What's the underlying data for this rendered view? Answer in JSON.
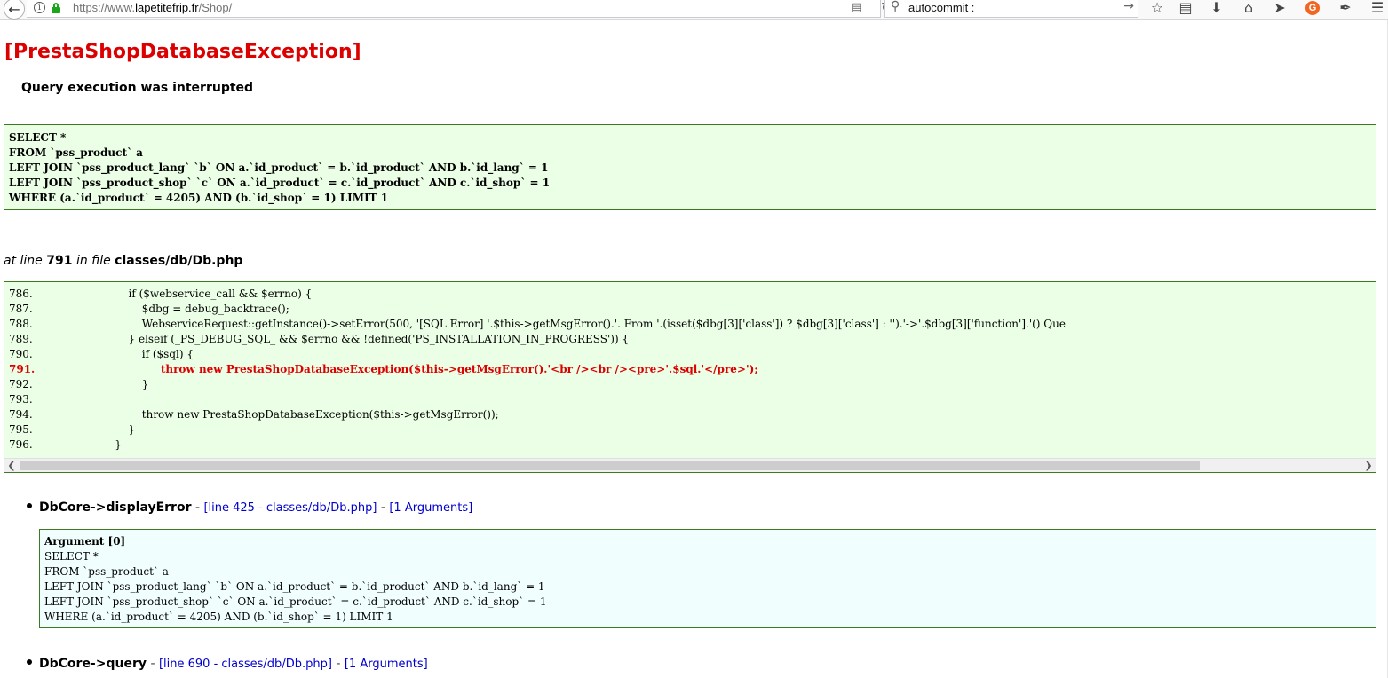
{
  "browser": {
    "url_prefix": "https://www.",
    "url_host": "lapetitefrip.fr",
    "url_path": "/Shop/",
    "search_value": "autocommit :",
    "icons": [
      "back-icon",
      "info-icon",
      "lock-icon",
      "reader-icon",
      "reload-icon",
      "search-icon",
      "go-icon",
      "bookmark-star-icon",
      "reading-list-icon",
      "download-icon",
      "home-icon",
      "send-icon",
      "g-extension-icon",
      "pen-icon",
      "menu-icon"
    ]
  },
  "error": {
    "title": "[PrestaShopDatabaseException]",
    "message": "Query execution was interrupted",
    "sql_lines": [
      "SELECT *",
      "FROM `pss_product` a",
      "LEFT JOIN `pss_product_lang` `b` ON a.`id_product` = b.`id_product` AND b.`id_lang` = 1",
      "LEFT JOIN `pss_product_shop` `c` ON a.`id_product` = c.`id_product` AND c.`id_shop` = 1",
      "WHERE (a.`id_product` = 4205) AND (b.`id_shop` = 1) LIMIT 1"
    ],
    "at_line_prefix": "at line",
    "line_number": "791",
    "in_file_text": "in file",
    "file_path": "classes/db/Db.php"
  },
  "code": [
    {
      "num": "786.",
      "text": "        if ($webservice_call && $errno) {",
      "highlight": false
    },
    {
      "num": "787.",
      "text": "            $dbg = debug_backtrace();",
      "highlight": false
    },
    {
      "num": "788.",
      "text": "            WebserviceRequest::getInstance()->setError(500, '[SQL Error] '.$this->getMsgError().'. From '.(isset($dbg[3]['class']) ? $dbg[3]['class'] : '').'->'.$dbg[3]['function'].'() Que",
      "highlight": false
    },
    {
      "num": "789.",
      "text": "        } elseif (_PS_DEBUG_SQL_ && $errno && !defined('PS_INSTALLATION_IN_PROGRESS')) {",
      "highlight": false
    },
    {
      "num": "790.",
      "text": "            if ($sql) {",
      "highlight": false
    },
    {
      "num": "791.",
      "text": "                throw new PrestaShopDatabaseException($this->getMsgError().'<br /><br /><pre>'.$sql.'</pre>');",
      "highlight": true
    },
    {
      "num": "792.",
      "text": "            }",
      "highlight": false
    },
    {
      "num": "793.",
      "text": "",
      "highlight": false
    },
    {
      "num": "794.",
      "text": "            throw new PrestaShopDatabaseException($this->getMsgError());",
      "highlight": false
    },
    {
      "num": "795.",
      "text": "        }",
      "highlight": false
    },
    {
      "num": "796.",
      "text": "    }",
      "highlight": false
    }
  ],
  "trace": [
    {
      "function": "DbCore->displayError",
      "separator": " - ",
      "line_link": "[line 425 - classes/db/Db.php]",
      "args_link": "[1 Arguments]"
    },
    {
      "function": "DbCore->query",
      "separator": " - ",
      "line_link": "[line 690 - classes/db/Db.php]",
      "args_link": "[1 Arguments]"
    }
  ],
  "argument": {
    "title": "Argument [0]",
    "lines": [
      "SELECT *",
      "FROM `pss_product` a",
      "LEFT JOIN `pss_product_lang` `b` ON a.`id_product` = b.`id_product` AND b.`id_lang` = 1",
      "LEFT JOIN `pss_product_shop` `c` ON a.`id_product` = c.`id_product` AND c.`id_shop` = 1",
      "WHERE (a.`id_product` = 4205) AND (b.`id_shop` = 1) LIMIT 1"
    ]
  },
  "colors": {
    "error_red": "#dc0000",
    "box_green_bg": "#ebffe6",
    "box_border": "#3c7a1f",
    "arg_bg": "#f0fffe",
    "link_blue": "#0000cc"
  }
}
